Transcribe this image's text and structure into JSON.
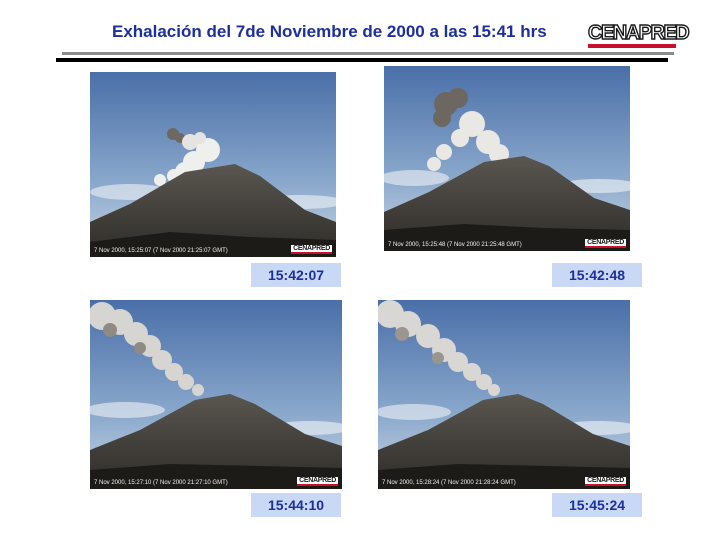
{
  "header": {
    "title": "Exhalación del 7de Noviembre de 2000 a las 15:41 hrs",
    "logo_text": "CENAPRED"
  },
  "frames": [
    {
      "stamp": "7 Nov 2000, 15:25:07 (7 Nov 2000 21:25:07 GMT)",
      "watermark": "CENAPRED",
      "time_label": "15:42:07"
    },
    {
      "stamp": "7 Nov 2000, 15:25:48 (7 Nov 2000 21:25:48 GMT)",
      "watermark": "CENAPRED",
      "time_label": "15:42:48"
    },
    {
      "stamp": "7 Nov 2000, 15:27:10 (7 Nov 2000 21:27:10 GMT)",
      "watermark": "CENAPRED",
      "time_label": "15:44:10"
    },
    {
      "stamp": "7 Nov 2000, 15:28:24 (7 Nov 2000 21:28:24 GMT)",
      "watermark": "CENAPRED",
      "time_label": "15:45:24"
    }
  ],
  "colors": {
    "title_blue": "#1c2f9c",
    "label_bg": "#c9d8f5",
    "logo_red": "#c8102e"
  }
}
